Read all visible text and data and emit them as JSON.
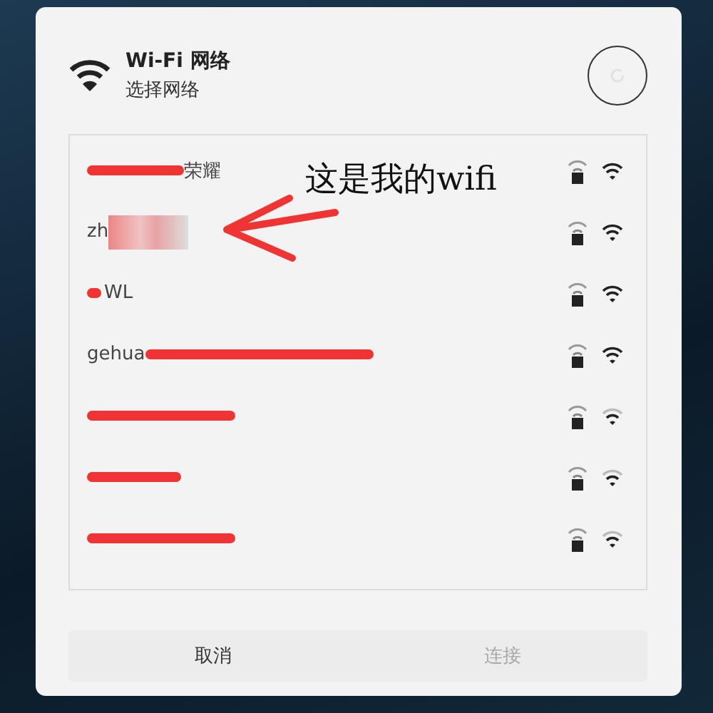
{
  "dialog": {
    "title": "Wi-Fi 网络",
    "subtitle": "选择网络"
  },
  "networks": [
    {
      "name": "荣耀",
      "kind": "prefixed",
      "secured": true,
      "strong": true
    },
    {
      "name": "zh",
      "kind": "blurred",
      "secured": true,
      "strong": true
    },
    {
      "name": "WL",
      "kind": "dotted",
      "secured": true,
      "strong": true
    },
    {
      "name": "gehua",
      "kind": "long",
      "secured": true,
      "strong": true
    },
    {
      "kind": "medium",
      "secured": true,
      "strong": false
    },
    {
      "kind": "short",
      "secured": true,
      "strong": false
    },
    {
      "kind": "medium",
      "secured": true,
      "strong": false
    }
  ],
  "annotation": {
    "text": "这是我的wifi"
  },
  "buttons": [
    {
      "label": "取消",
      "disabled": false
    },
    {
      "label": "连接",
      "disabled": true
    }
  ]
}
